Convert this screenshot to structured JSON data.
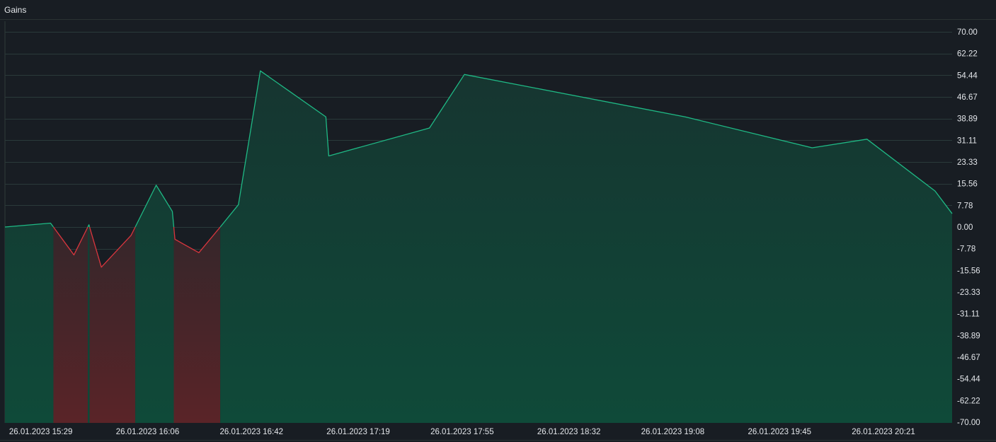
{
  "header": {
    "title": "Gains"
  },
  "colors": {
    "positive_line": "#1fb985",
    "negative_line": "#d9363e",
    "grid": "#2a3a3a",
    "background": "#181d23"
  },
  "chart_data": {
    "type": "area",
    "title": "Gains",
    "xlabel": "",
    "ylabel": "",
    "ylim": [
      -70,
      70
    ],
    "y_ticks": [
      "70.00",
      "62.22",
      "54.44",
      "46.67",
      "38.89",
      "31.11",
      "23.33",
      "15.56",
      "7.78",
      "0.00",
      "-7.78",
      "-15.56",
      "-23.33",
      "-31.11",
      "-38.89",
      "-46.67",
      "-54.44",
      "-62.22",
      "-70.00"
    ],
    "x_ticks": [
      {
        "label": "26.01.2023 15:29",
        "x": 0
      },
      {
        "label": "26.01.2023 16:06",
        "x": 37
      },
      {
        "label": "26.01.2023 16:42",
        "x": 73
      },
      {
        "label": "26.01.2023 17:19",
        "x": 110
      },
      {
        "label": "26.01.2023 17:55",
        "x": 146
      },
      {
        "label": "26.01.2023 18:32",
        "x": 183
      },
      {
        "label": "26.01.2023 19:08",
        "x": 219
      },
      {
        "label": "26.01.2023 19:45",
        "x": 256
      },
      {
        "label": "26.01.2023 20:21",
        "x": 292
      }
    ],
    "xlim": [
      -0.7,
      327.5
    ],
    "x_unit": "minutes after 26.01.2023 15:29",
    "series": [
      {
        "name": "",
        "x": [
          -0.7,
          15.1,
          23.2,
          28.4,
          32.7,
          43.0,
          51.7,
          57.3,
          58.2,
          66.5,
          73.9,
          80.2,
          87.8,
          110.5,
          111.5,
          146.4,
          158.5,
          235.0,
          279.0,
          298.0,
          321.6,
          327.5
        ],
        "y": [
          0.0,
          1.4,
          -10.0,
          0.8,
          -14.4,
          -3.0,
          15.0,
          5.6,
          -4.4,
          -9.2,
          0.0,
          8.0,
          56.0,
          39.5,
          25.5,
          35.5,
          54.7,
          39.5,
          28.4,
          31.5,
          12.9,
          4.8
        ]
      }
    ],
    "grid": true,
    "legend": "none",
    "fill": "area colored green above 0, red below 0"
  }
}
